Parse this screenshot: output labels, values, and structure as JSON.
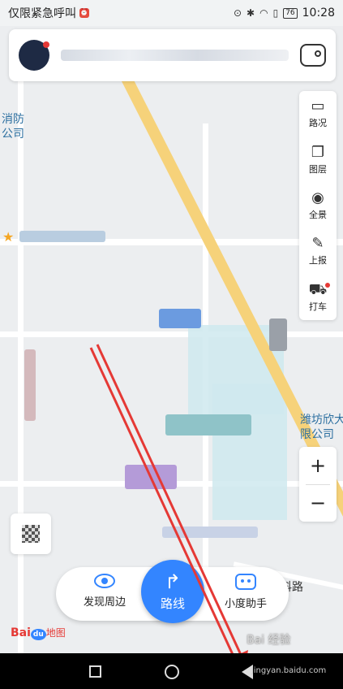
{
  "status_bar": {
    "carrier_text": "仅限紧急呼叫",
    "battery_level": "76",
    "time": "10:28"
  },
  "map": {
    "label_left_top": "消防\n公司",
    "label_right": "潍坊欣大\n限公司",
    "label_road": "科路"
  },
  "right_toolbar": {
    "items": [
      {
        "label": "路况",
        "icon": "traffic-icon"
      },
      {
        "label": "图层",
        "icon": "layers-icon"
      },
      {
        "label": "全景",
        "icon": "panorama-icon"
      },
      {
        "label": "上报",
        "icon": "report-icon"
      },
      {
        "label": "打车",
        "icon": "taxi-icon"
      }
    ]
  },
  "zoom": {
    "in_label": "+",
    "out_label": "−"
  },
  "action_bar": {
    "discover_label": "发现周边",
    "route_label": "路线",
    "assistant_label": "小度助手"
  },
  "logo": {
    "text_bai": "Bai",
    "text_du": "du",
    "text_map": "地图"
  },
  "watermark": {
    "brand": "Bai 经验",
    "url": "jingyan.baidu.com"
  },
  "colors": {
    "accent": "#3385ff",
    "alert": "#e53935",
    "road": "#f6d27a"
  }
}
